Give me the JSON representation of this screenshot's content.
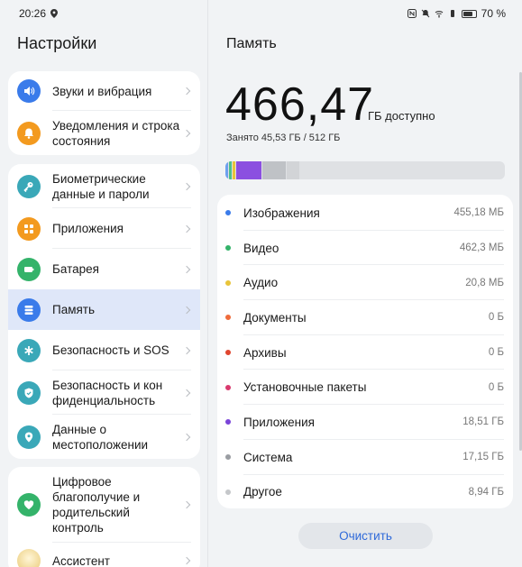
{
  "status": {
    "time": "20:26",
    "battery": "70 %"
  },
  "left": {
    "title": "Настройки",
    "cards": [
      {
        "items": [
          {
            "label": "Звуки и вибрация",
            "icon": "speaker-icon",
            "color": "#3a7bea"
          },
          {
            "label": "Уведомления и строка состояния",
            "icon": "bell-icon",
            "color": "#f39a1f"
          }
        ]
      },
      {
        "items": [
          {
            "label": "Биометрические данные и пароли",
            "icon": "key-icon",
            "color": "#3aa8b8"
          },
          {
            "label": "Приложения",
            "icon": "apps-icon",
            "color": "#f39a1f"
          },
          {
            "label": "Батарея",
            "icon": "battery-icon",
            "color": "#34b36a"
          },
          {
            "label": "Память",
            "icon": "storage-icon",
            "color": "#3a7bea",
            "active": true
          },
          {
            "label": "Безопасность и SOS",
            "icon": "asterisk-icon",
            "color": "#3aa8b8"
          },
          {
            "label": "Безопасность и кон фиденциальность",
            "icon": "shield-icon",
            "color": "#3aa8b8"
          },
          {
            "label": "Данные о местоположении",
            "icon": "location-icon",
            "color": "#3aa8b8"
          }
        ]
      },
      {
        "items": [
          {
            "label": "Цифровое благополучие и родительский контроль",
            "icon": "heart-icon",
            "color": "#34b36a"
          },
          {
            "label": "Ассистент",
            "icon": "assistant-icon",
            "color": "#e9c872"
          }
        ]
      }
    ]
  },
  "right": {
    "title": "Память",
    "available_value": "466,47",
    "available_unit": "ГБ доступно",
    "used_text": "Занято 45,53 ГБ / 512 ГБ",
    "bar_segments": [
      {
        "color": "#6ea0ee",
        "fraction": 0.0012
      },
      {
        "color": "#4cc08a",
        "fraction": 0.0012
      },
      {
        "color": "#e8c43a",
        "fraction": 5e-05
      },
      {
        "color": "#8b4fe0",
        "fraction": 0.036
      },
      {
        "color": "#bfc2c6",
        "fraction": 0.0335
      },
      {
        "color": "#d2d4d7",
        "fraction": 0.0175
      }
    ],
    "categories": [
      {
        "name": "Изображения",
        "size": "455,18 МБ",
        "color": "#3a7bea"
      },
      {
        "name": "Видео",
        "size": "462,3 МБ",
        "color": "#34b36a"
      },
      {
        "name": "Аудио",
        "size": "20,8 МБ",
        "color": "#e8c43a"
      },
      {
        "name": "Документы",
        "size": "0 Б",
        "color": "#ef6b3a"
      },
      {
        "name": "Архивы",
        "size": "0 Б",
        "color": "#e0462f"
      },
      {
        "name": "Установочные пакеты",
        "size": "0 Б",
        "color": "#d93a6e"
      },
      {
        "name": "Приложения",
        "size": "18,51 ГБ",
        "color": "#7a44d8"
      },
      {
        "name": "Система",
        "size": "17,15 ГБ",
        "color": "#9a9da2"
      },
      {
        "name": "Другое",
        "size": "8,94 ГБ",
        "color": "#c5c7ca"
      }
    ],
    "clear_label": "Очистить"
  }
}
